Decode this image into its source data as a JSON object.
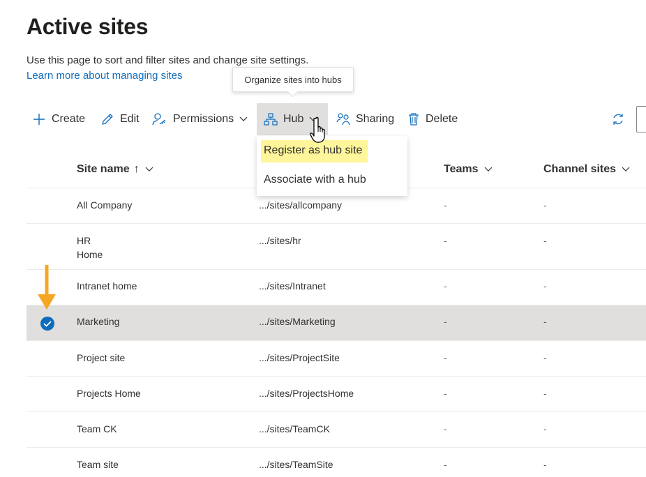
{
  "page": {
    "title": "Active sites",
    "description": "Use this page to sort and filter sites and change site settings.",
    "learn_link": "Learn more about managing sites"
  },
  "tooltip": {
    "text": "Organize sites into hubs"
  },
  "toolbar": {
    "create_label": "Create",
    "edit_label": "Edit",
    "permissions_label": "Permissions",
    "hub_label": "Hub",
    "sharing_label": "Sharing",
    "delete_label": "Delete"
  },
  "hub_menu": {
    "items": [
      {
        "label": "Register as hub site",
        "highlighted": true
      },
      {
        "label": "Associate with a hub",
        "highlighted": false
      }
    ]
  },
  "table": {
    "columns": {
      "site_name": "Site name",
      "sort_indicator": "↑",
      "teams": "Teams",
      "channel_sites": "Channel sites"
    },
    "rows": [
      {
        "name": "All Company",
        "url": ".../sites/allcompany",
        "teams": "-",
        "channel": "-",
        "selected": false
      },
      {
        "name": "HR",
        "name_line2": "Home",
        "url": ".../sites/hr",
        "teams": "-",
        "channel": "-",
        "selected": false
      },
      {
        "name": "Intranet home",
        "url": ".../sites/Intranet",
        "teams": "-",
        "channel": "-",
        "selected": false
      },
      {
        "name": "Marketing",
        "url": ".../sites/Marketing",
        "teams": "-",
        "channel": "-",
        "selected": true
      },
      {
        "name": "Project site",
        "url": ".../sites/ProjectSite",
        "teams": "-",
        "channel": "-",
        "selected": false
      },
      {
        "name": "Projects Home",
        "url": ".../sites/ProjectsHome",
        "teams": "-",
        "channel": "-",
        "selected": false
      },
      {
        "name": "Team CK",
        "url": ".../sites/TeamCK",
        "teams": "-",
        "channel": "-",
        "selected": false
      },
      {
        "name": "Team site",
        "url": ".../sites/TeamSite",
        "teams": "-",
        "channel": "-",
        "selected": false
      }
    ]
  },
  "colors": {
    "accent": "#0f6cbd",
    "selected_row": "#e1dfdd",
    "highlight": "#fff59a",
    "annotation_arrow": "#f5a623"
  }
}
